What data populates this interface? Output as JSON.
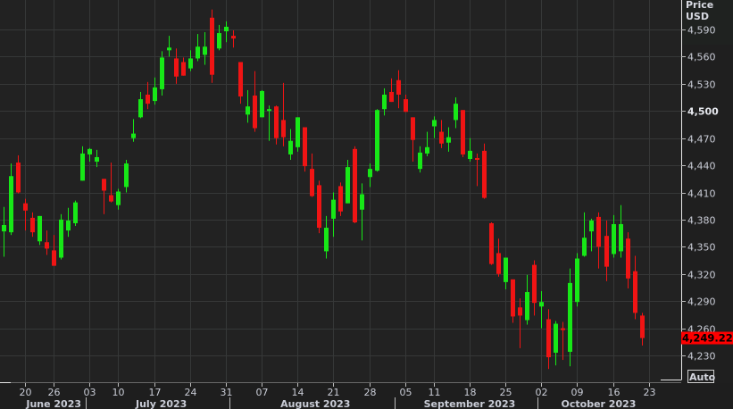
{
  "chart_data": {
    "type": "candlestick",
    "title": "",
    "ylabel": "Price USD",
    "axis_title_line1": "Price",
    "axis_title_line2": "USD",
    "ylim": [
      4200,
      4620
    ],
    "y_ticks": [
      "4,590",
      "4,560",
      "4,530",
      "4,500",
      "4,470",
      "4,440",
      "4,410",
      "4,380",
      "4,350",
      "4,320",
      "4,290",
      "4,260",
      "4,230"
    ],
    "y_tick_values": [
      4590,
      4560,
      4530,
      4500,
      4470,
      4440,
      4410,
      4380,
      4350,
      4320,
      4290,
      4260,
      4230
    ],
    "bold_tick": "4,500",
    "last_price_label": "4,249.22",
    "last_price": 4249.22,
    "auto_button": "Auto",
    "grid": true,
    "colors": {
      "up": "#17e817",
      "down": "#f01414",
      "background": "#222222",
      "grid": "#363838",
      "last_price_bg": "#ff0000"
    },
    "x_ticks": [
      {
        "label": "20",
        "index": 3
      },
      {
        "label": "26",
        "index": 7
      },
      {
        "label": "03",
        "index": 12
      },
      {
        "label": "10",
        "index": 16
      },
      {
        "label": "17",
        "index": 21
      },
      {
        "label": "24",
        "index": 26
      },
      {
        "label": "31",
        "index": 31
      },
      {
        "label": "07",
        "index": 36
      },
      {
        "label": "14",
        "index": 41
      },
      {
        "label": "21",
        "index": 46
      },
      {
        "label": "28",
        "index": 51
      },
      {
        "label": "05",
        "index": 56
      },
      {
        "label": "11",
        "index": 60
      },
      {
        "label": "18",
        "index": 65
      },
      {
        "label": "25",
        "index": 70
      },
      {
        "label": "02",
        "index": 75
      },
      {
        "label": "09",
        "index": 80
      },
      {
        "label": "16",
        "index": 85
      },
      {
        "label": "23",
        "index": 90
      }
    ],
    "months": [
      {
        "label": "June 2023",
        "center_index": 7,
        "start_index": null
      },
      {
        "label": "July 2023",
        "center_index": 22,
        "start_index": 12
      },
      {
        "label": "August 2023",
        "center_index": 43.5,
        "start_index": 32
      },
      {
        "label": "September 2023",
        "center_index": 65,
        "start_index": 55
      },
      {
        "label": "October 2023",
        "center_index": 83,
        "start_index": 75
      }
    ],
    "ohlc_columns": [
      "open",
      "high",
      "low",
      "close"
    ],
    "ohlc": [
      [
        4367,
        4394,
        4339,
        4374
      ],
      [
        4366,
        4442,
        4363,
        4428
      ],
      [
        4443,
        4451,
        4409,
        4410
      ],
      [
        4398,
        4403,
        4368,
        4390
      ],
      [
        4382,
        4388,
        4361,
        4366
      ],
      [
        4356,
        4384,
        4352,
        4384
      ],
      [
        4355,
        4368,
        4341,
        4348
      ],
      [
        4346,
        4363,
        4329,
        4329
      ],
      [
        4338,
        4386,
        4336,
        4380
      ],
      [
        4368,
        4393,
        4361,
        4379
      ],
      [
        4376,
        4401,
        4373,
        4399
      ],
      [
        4423,
        4461,
        4423,
        4453
      ],
      [
        4452,
        4459,
        4444,
        4458
      ],
      [
        4444,
        4457,
        4438,
        4449
      ],
      [
        4425,
        4425,
        4386,
        4412
      ],
      [
        4407,
        4443,
        4399,
        4400
      ],
      [
        4396,
        4414,
        4391,
        4411
      ],
      [
        4416,
        4446,
        4410,
        4442
      ],
      [
        4470,
        4491,
        4466,
        4475
      ],
      [
        4493,
        4521,
        4492,
        4513
      ],
      [
        4518,
        4532,
        4502,
        4508
      ],
      [
        4511,
        4537,
        4507,
        4526
      ],
      [
        4524,
        4566,
        4517,
        4559
      ],
      [
        4567,
        4583,
        4560,
        4570
      ],
      [
        4558,
        4569,
        4530,
        4538
      ],
      [
        4554,
        4559,
        4539,
        4539
      ],
      [
        4547,
        4567,
        4544,
        4558
      ],
      [
        4558,
        4585,
        4555,
        4571
      ],
      [
        4562,
        4587,
        4551,
        4571
      ],
      [
        4603,
        4612,
        4531,
        4540
      ],
      [
        4569,
        4595,
        4567,
        4586
      ],
      [
        4588,
        4599,
        4576,
        4593
      ],
      [
        4583,
        4589,
        4570,
        4580
      ],
      [
        4554,
        4554,
        4508,
        4516
      ],
      [
        4496,
        4523,
        4487,
        4505
      ],
      [
        4517,
        4544,
        4477,
        4481
      ],
      [
        4493,
        4523,
        4493,
        4522
      ],
      [
        4500,
        4506,
        4467,
        4502
      ],
      [
        4505,
        4506,
        4463,
        4470
      ],
      [
        4490,
        4531,
        4461,
        4471
      ],
      [
        4452,
        4480,
        4446,
        4467
      ],
      [
        4460,
        4493,
        4455,
        4493
      ],
      [
        4482,
        4482,
        4433,
        4439
      ],
      [
        4436,
        4453,
        4405,
        4406
      ],
      [
        4418,
        4423,
        4365,
        4371
      ],
      [
        4345,
        4384,
        4337,
        4371
      ],
      [
        4381,
        4410,
        4361,
        4402
      ],
      [
        4417,
        4421,
        4384,
        4389
      ],
      [
        4398,
        4446,
        4398,
        4438
      ],
      [
        4458,
        4461,
        4376,
        4377
      ],
      [
        4391,
        4420,
        4357,
        4408
      ],
      [
        4427,
        4442,
        4416,
        4436
      ],
      [
        4434,
        4502,
        4433,
        4501
      ],
      [
        4502,
        4525,
        4495,
        4518
      ],
      [
        4521,
        4536,
        4510,
        4510
      ],
      [
        4534,
        4545,
        4503,
        4518
      ],
      [
        4513,
        4518,
        4499,
        4499
      ],
      [
        4493,
        4493,
        4444,
        4468
      ],
      [
        4436,
        4461,
        4432,
        4454
      ],
      [
        4453,
        4477,
        4450,
        4460
      ],
      [
        4483,
        4494,
        4470,
        4490
      ],
      [
        4477,
        4490,
        4459,
        4464
      ],
      [
        4465,
        4482,
        4455,
        4471
      ],
      [
        4490,
        4515,
        4481,
        4508
      ],
      [
        4501,
        4501,
        4449,
        4452
      ],
      [
        4447,
        4470,
        4444,
        4456
      ],
      [
        4448,
        4453,
        4417,
        4446
      ],
      [
        4456,
        4464,
        4403,
        4404
      ],
      [
        4376,
        4377,
        4330,
        4331
      ],
      [
        4343,
        4359,
        4317,
        4320
      ],
      [
        4311,
        4338,
        4303,
        4338
      ],
      [
        4314,
        4314,
        4266,
        4273
      ],
      [
        4283,
        4293,
        4238,
        4274
      ],
      [
        4269,
        4319,
        4264,
        4300
      ],
      [
        4330,
        4335,
        4274,
        4288
      ],
      [
        4284,
        4301,
        4260,
        4289
      ],
      [
        4270,
        4281,
        4215,
        4228
      ],
      [
        4233,
        4268,
        4219,
        4265
      ],
      [
        4260,
        4267,
        4225,
        4258
      ],
      [
        4234,
        4326,
        4218,
        4310
      ],
      [
        4289,
        4343,
        4284,
        4337
      ],
      [
        4340,
        4388,
        4339,
        4360
      ],
      [
        4367,
        4381,
        4345,
        4379
      ],
      [
        4383,
        4388,
        4326,
        4350
      ],
      [
        4362,
        4379,
        4312,
        4328
      ],
      [
        4342,
        4385,
        4338,
        4375
      ],
      [
        4345,
        4396,
        4338,
        4375
      ],
      [
        4359,
        4366,
        4304,
        4315
      ],
      [
        4323,
        4340,
        4270,
        4277
      ],
      [
        4274,
        4277,
        4241,
        4249.22
      ]
    ]
  }
}
